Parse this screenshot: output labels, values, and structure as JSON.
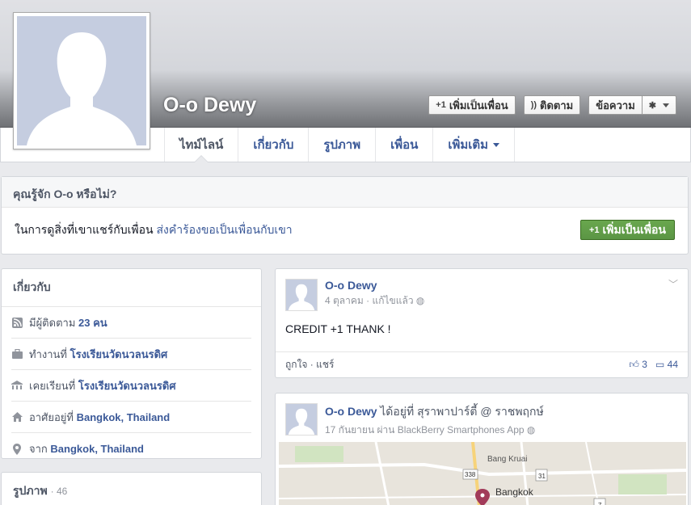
{
  "profile": {
    "name": "O-o Dewy",
    "buttons": {
      "add_friend": "เพิ่มเป็นเพื่อน",
      "follow": "ติดตาม",
      "message": "ข้อความ"
    }
  },
  "tabs": [
    {
      "label": "ไทม์ไลน์"
    },
    {
      "label": "เกี่ยวกับ"
    },
    {
      "label": "รูปภาพ"
    },
    {
      "label": "เพื่อน"
    },
    {
      "label": "เพิ่มเติม"
    }
  ],
  "know": {
    "title": "คุณรู้จัก O-o หรือไม่?",
    "text": "ในการดูสิ่งที่เขาแชร์กับเพื่อน",
    "link": "ส่งคำร้องขอเป็นเพื่อนกับเขา",
    "button": "เพิ่มเป็นเพื่อน"
  },
  "about": {
    "title": "เกี่ยวกับ",
    "items": [
      {
        "icon": "rss-icon",
        "prefix": "มีผู้ติดตาม",
        "value": "23 คน"
      },
      {
        "icon": "briefcase-icon",
        "prefix": "ทำงานที่",
        "value": "โรงเรียนวัดนวลนรดิศ"
      },
      {
        "icon": "education-icon",
        "prefix": "เคยเรียนที่",
        "value": "โรงเรียนวัดนวลนรดิศ"
      },
      {
        "icon": "home-icon",
        "prefix": "อาศัยอยู่ที่",
        "value": "Bangkok, Thailand"
      },
      {
        "icon": "location-pin-icon",
        "prefix": "จาก",
        "value": "Bangkok, Thailand"
      }
    ]
  },
  "photos": {
    "title": "รูปภาพ",
    "count": "· 46"
  },
  "posts": [
    {
      "name": "O-o Dewy",
      "meta": "4 ตุลาคม · แก้ไขแล้ว",
      "text": "CREDIT +1 THANK !",
      "actions": "ถูกใจ · แชร์",
      "likes": "3",
      "comments": "44"
    },
    {
      "name": "O-o Dewy",
      "extra": "ได้อยู่ที่ สุราพาปาร์ตี้ @ ราชพฤกษ์",
      "meta": "17 กันยายน ผ่าน BlackBerry Smartphones App",
      "map_labels": {
        "area": "Bang Kruai",
        "city": "Bangkok",
        "road1": "338",
        "road2": "31",
        "road3": "7"
      }
    }
  ],
  "colors": {
    "link": "#3b5998",
    "green": "#5b9544",
    "bg": "#e9eaed"
  }
}
